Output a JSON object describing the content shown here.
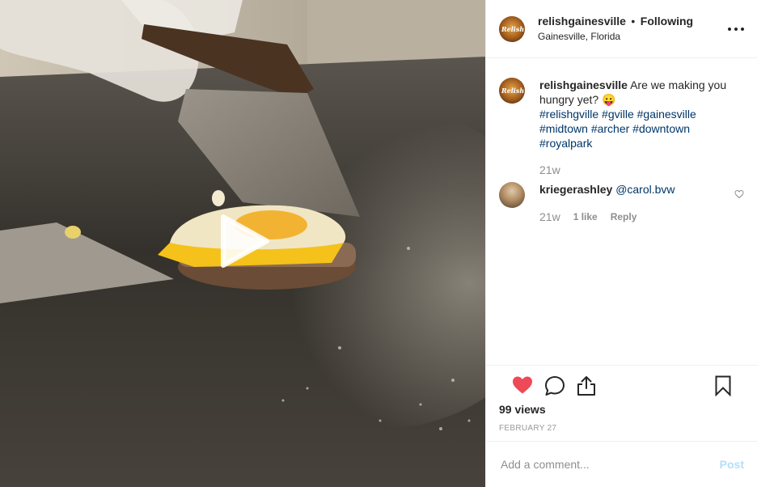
{
  "post": {
    "username": "relishgainesville",
    "separator": "•",
    "follow_status": "Following",
    "location": "Gainesville, Florida",
    "avatar_text": "Relish",
    "caption": {
      "username": "relishgainesville",
      "text": "Are we making you hungry yet? 😛",
      "hashtags": [
        "#relishgville",
        "#gville",
        "#gainesville",
        "#midtown",
        "#archer",
        "#downtown",
        "#royalpark"
      ],
      "time": "21w"
    },
    "comments": [
      {
        "username": "kriegerashley",
        "mention": "@carol.bvw",
        "time": "21w",
        "likes": "1 like",
        "reply_label": "Reply"
      }
    ],
    "views": "99 views",
    "date": "FEBRUARY 27",
    "liked": true
  },
  "composer": {
    "placeholder": "Add a comment...",
    "post_label": "Post"
  },
  "colors": {
    "like_red": "#ed4956",
    "link_blue": "#003569",
    "post_disabled": "#b2dffc",
    "muted": "#8e8e8e"
  },
  "icons": {
    "play": "play-icon",
    "more": "more-options-icon",
    "like": "heart-icon",
    "comment": "comment-icon",
    "share": "share-icon",
    "save": "bookmark-icon",
    "comment_like": "heart-outline-icon"
  }
}
